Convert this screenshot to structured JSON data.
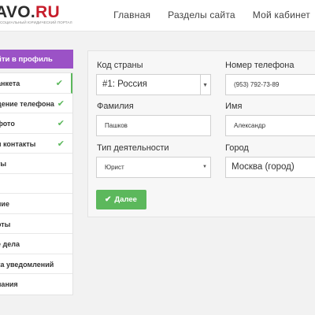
{
  "header": {
    "logo_prefix": "AVO.",
    "logo_accent": "RU",
    "logo_tagline": "социальный юридический портал",
    "nav": [
      "Главная",
      "Разделы сайта",
      "Мой кабинет"
    ]
  },
  "sidebar": {
    "profile_button": "йти в профиль",
    "items": [
      {
        "label": "анкета",
        "checked": true,
        "active": true
      },
      {
        "label": "дение телефона",
        "checked": true
      },
      {
        "label": "фото",
        "checked": true
      },
      {
        "label": "и контакты",
        "checked": true
      },
      {
        "label": "ты",
        "checked": false
      },
      {
        "label": "",
        "checked": false
      },
      {
        "label": "ние",
        "checked": false
      },
      {
        "label": "оты",
        "checked": false
      },
      {
        "label": "е дела",
        "checked": false
      },
      {
        "label": "ка уведомлений",
        "checked": false
      },
      {
        "label": "пания",
        "checked": false
      }
    ],
    "check_glyph": "✔"
  },
  "form": {
    "country_code_label": "Код страны",
    "country_code_value": "#1: Россия",
    "phone_label": "Номер телефона",
    "phone_value": "(953) 792-73-89",
    "surname_label": "Фамилия",
    "surname_value": "Пашков",
    "name_label": "Имя",
    "name_value": "Александр",
    "activity_label": "Тип деятельности",
    "activity_value": "Юрист",
    "city_label": "Город",
    "city_value": "Москва (город)",
    "caret_glyph": "▼",
    "next_icon": "✔",
    "next_label": "Далее"
  },
  "colors": {
    "accent_purple": "#9b52c6",
    "success_green": "#5cb85c",
    "logo_red": "#c71d2b"
  }
}
